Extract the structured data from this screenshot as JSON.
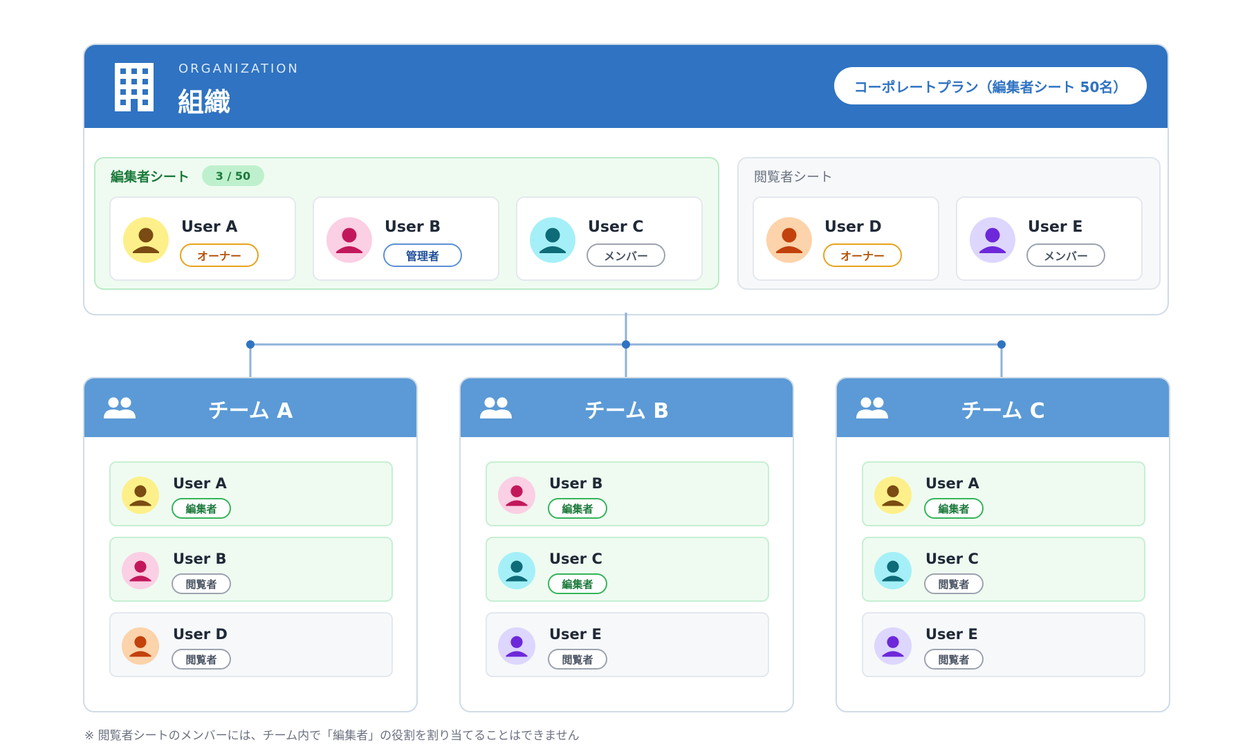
{
  "org": {
    "subtitle": "ORGANIZATION",
    "title": "組織",
    "plan": "コーポレートプラン（編集者シート 50名）",
    "editor_seats": {
      "title": "編集者シート",
      "count": "3 / 50",
      "users": [
        {
          "name": "User A",
          "role": "オーナー",
          "role_type": "owner",
          "avatar": "yellow"
        },
        {
          "name": "User B",
          "role": "管理者",
          "role_type": "admin",
          "avatar": "pink"
        },
        {
          "name": "User C",
          "role": "メンバー",
          "role_type": "member",
          "avatar": "cyan"
        }
      ]
    },
    "viewer_seats": {
      "title": "閲覧者シート",
      "users": [
        {
          "name": "User D",
          "role": "オーナー",
          "role_type": "owner",
          "avatar": "orange"
        },
        {
          "name": "User E",
          "role": "メンバー",
          "role_type": "member",
          "avatar": "purple"
        }
      ]
    }
  },
  "teams": [
    {
      "title": "チーム A",
      "members": [
        {
          "name": "User A",
          "role": "編集者",
          "role_type": "editor",
          "avatar": "yellow"
        },
        {
          "name": "User B",
          "role": "閲覧者",
          "role_type": "editor-viewer",
          "avatar": "pink"
        },
        {
          "name": "User D",
          "role": "閲覧者",
          "role_type": "viewer",
          "avatar": "orange"
        }
      ]
    },
    {
      "title": "チーム B",
      "members": [
        {
          "name": "User B",
          "role": "編集者",
          "role_type": "editor",
          "avatar": "pink"
        },
        {
          "name": "User C",
          "role": "編集者",
          "role_type": "editor",
          "avatar": "cyan"
        },
        {
          "name": "User E",
          "role": "閲覧者",
          "role_type": "viewer",
          "avatar": "purple"
        }
      ]
    },
    {
      "title": "チーム C",
      "members": [
        {
          "name": "User A",
          "role": "編集者",
          "role_type": "editor",
          "avatar": "yellow"
        },
        {
          "name": "User C",
          "role": "閲覧者",
          "role_type": "editor-viewer",
          "avatar": "cyan"
        },
        {
          "name": "User E",
          "role": "閲覧者",
          "role_type": "viewer",
          "avatar": "purple"
        }
      ]
    }
  ],
  "avatar_colors": {
    "yellow": {
      "bg": "#fdf08a",
      "fg": "#7a4b12"
    },
    "pink": {
      "bg": "#fbcfe4",
      "fg": "#c2185b"
    },
    "cyan": {
      "bg": "#a5f0f8",
      "fg": "#0e6b78"
    },
    "orange": {
      "bg": "#fcd3aa",
      "fg": "#c2410c"
    },
    "purple": {
      "bg": "#ddd6fe",
      "fg": "#6d28d9"
    }
  },
  "colors": {
    "header": "#2f73c2",
    "team_header": "#5b9ad6",
    "connector": "#8fb2d9",
    "connector_dot": "#2f73c2"
  },
  "footnote": "※ 閲覧者シートのメンバーには、チーム内で「編集者」の役割を割り当てることはできません"
}
